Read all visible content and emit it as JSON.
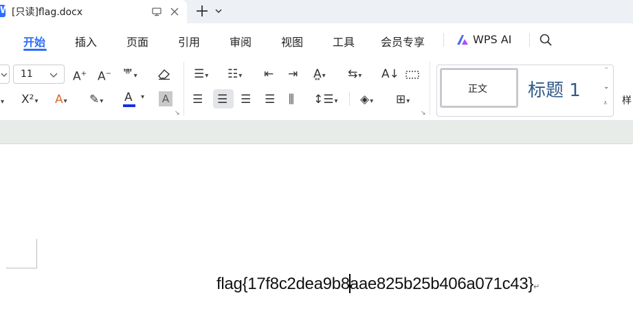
{
  "tab": {
    "icon_letter": "W",
    "title": "[只读]flag.docx",
    "monitor_icon": "monitor-icon",
    "close_icon": "close-icon",
    "new_tab_icon": "plus-icon"
  },
  "menu": {
    "items": [
      "开始",
      "插入",
      "页面",
      "引用",
      "审阅",
      "视图",
      "工具",
      "会员专享",
      "WPS AI"
    ],
    "search_icon": "search-icon",
    "accent_color": "#2b6ef7"
  },
  "ribbon": {
    "font_size_value": "11",
    "superscript_label": "X²",
    "styles": {
      "normal": "正文",
      "heading1": "标题 1",
      "more_label": "样"
    }
  },
  "document": {
    "text_before_cursor": "flag{17f8c2dea9b8",
    "text_after_cursor": "aae825b25b406a071c43}",
    "paragraph_mark": "↵"
  }
}
